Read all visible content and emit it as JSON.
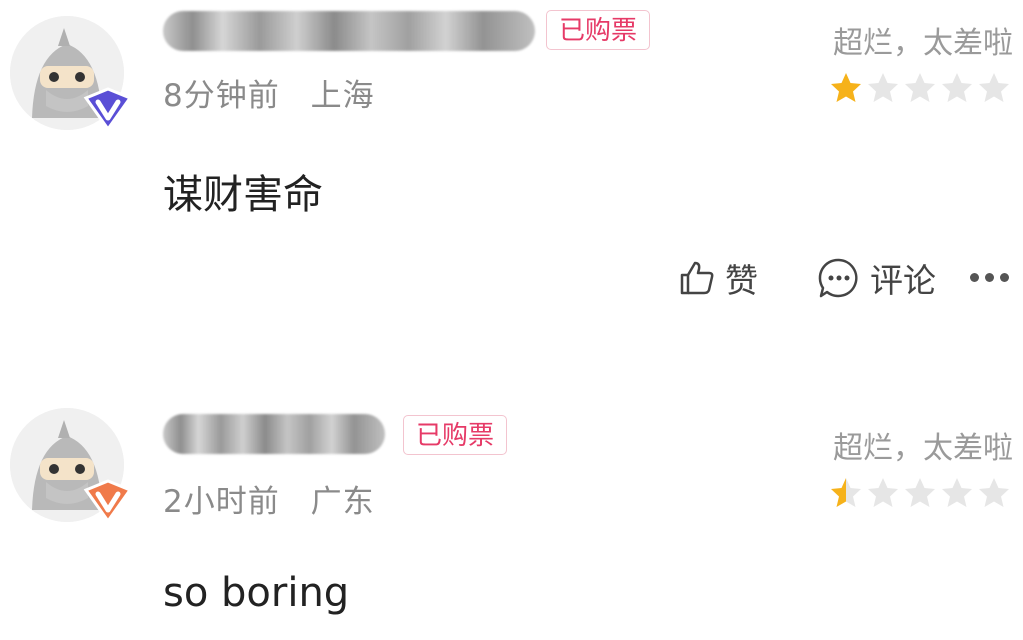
{
  "comments": [
    {
      "badge": "已购票",
      "time": "8分钟前",
      "location": "上海",
      "rating_text": "超烂，太差啦",
      "rating_stars": 1,
      "content": "谋财害命",
      "badge_color": "#5a4fd6",
      "like_label": "赞",
      "reply_label": "评论"
    },
    {
      "badge": "已购票",
      "time": "2小时前",
      "location": "广东",
      "rating_text": "超烂，太差啦",
      "rating_stars": 0.5,
      "content": "so boring",
      "badge_color": "#f07a4a"
    }
  ],
  "colors": {
    "star_filled": "#f6b21a",
    "star_empty": "#e6e6e6",
    "ticket_badge": "#e63a67"
  }
}
